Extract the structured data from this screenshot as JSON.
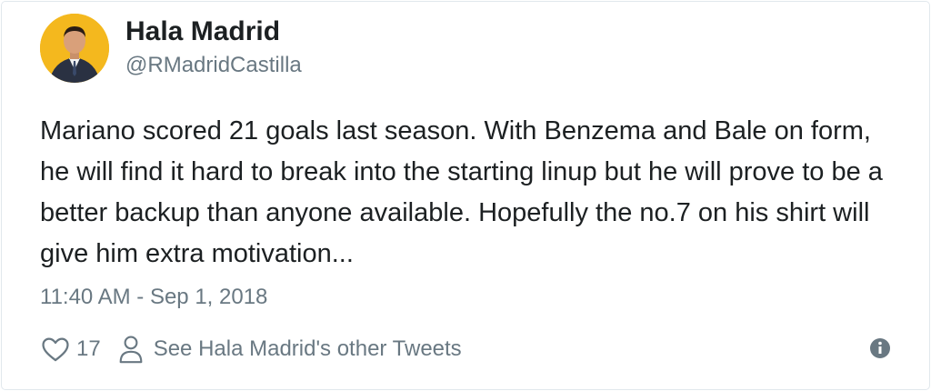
{
  "user": {
    "name": "Hala Madrid",
    "handle": "@RMadridCastilla",
    "avatar_icon": "profile-photo"
  },
  "tweet": {
    "text": "Mariano scored 21 goals last season. With Benzema and Bale on form, he will find it hard to break into the starting linup but he will prove to be a better backup than anyone available. Hopefully the no.7 on his shirt will give him extra motivation...",
    "timestamp": "11:40 AM - Sep 1, 2018"
  },
  "actions": {
    "like_icon": "heart-icon",
    "like_count": "17",
    "profile_icon": "person-icon",
    "other_tweets_label": "See Hala Madrid's other Tweets",
    "info_icon": "info-icon"
  },
  "colors": {
    "avatar_bg": "#f4b81e",
    "text": "#1c2022",
    "muted": "#697882",
    "border": "#e1e8ed"
  }
}
